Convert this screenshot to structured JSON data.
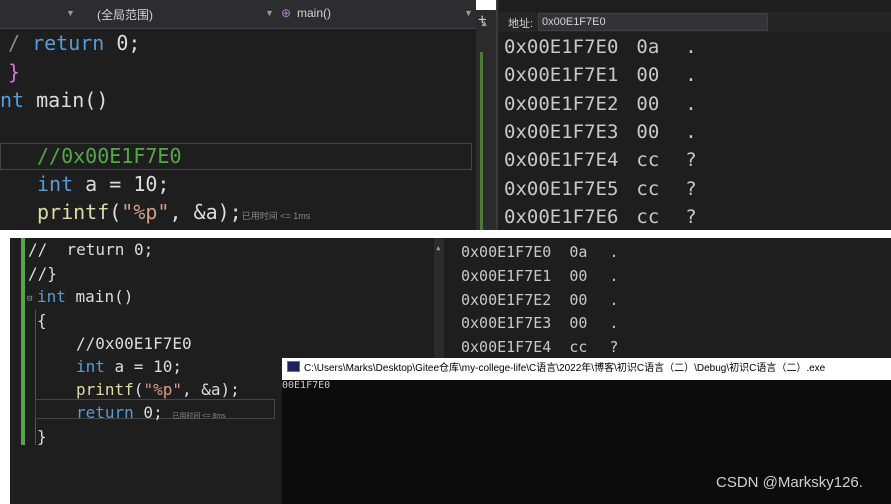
{
  "top": {
    "nav": {
      "scope": "(全局范围)",
      "function_icon": "function-icon",
      "function": "main()"
    },
    "code_lines": {
      "l1_kw": "return",
      "l1_rest": " 0;",
      "l2": "}",
      "l3_kw": "nt",
      "l3_rest": " main()",
      "l5": "//0x00E1F7E0",
      "l6_kw": "int",
      "l6_rest": " a = 10;",
      "l7_fn": "printf",
      "l7_open": "(",
      "l7_str": "\"%p\"",
      "l7_rest": ", &a);",
      "l7_hint": "已用时间 <= 1ms"
    },
    "memory": {
      "address_label": "地址:",
      "address_value": "0x00E1F7E0",
      "rows": [
        {
          "addr": "0x00E1F7E0",
          "hex": "0a",
          "ch": "."
        },
        {
          "addr": "0x00E1F7E1",
          "hex": "00",
          "ch": "."
        },
        {
          "addr": "0x00E1F7E2",
          "hex": "00",
          "ch": "."
        },
        {
          "addr": "0x00E1F7E3",
          "hex": "00",
          "ch": "."
        },
        {
          "addr": "0x00E1F7E4",
          "hex": "cc",
          "ch": "?"
        },
        {
          "addr": "0x00E1F7E5",
          "hex": "cc",
          "ch": "?"
        },
        {
          "addr": "0x00E1F7E6",
          "hex": "cc",
          "ch": "?"
        }
      ]
    }
  },
  "bottom": {
    "code_lines": {
      "c1": "//  return 0;",
      "c2": "//}",
      "c3_kw": "int",
      "c3_rest": " main()",
      "c4": "{",
      "c5": "//0x00E1F7E0",
      "c6_kw": "int",
      "c6_rest": " a = 10;",
      "c7_fn": "printf",
      "c7_open": "(",
      "c7_str": "\"%p\"",
      "c7_rest": ", &a);",
      "c8_kw": "return",
      "c8_rest": " 0;",
      "c8_hint": "已用时间 <= 8ms",
      "c9": "}"
    },
    "memory_rows": [
      {
        "addr": "0x00E1F7E0",
        "hex": "0a",
        "ch": "."
      },
      {
        "addr": "0x00E1F7E1",
        "hex": "00",
        "ch": "."
      },
      {
        "addr": "0x00E1F7E2",
        "hex": "00",
        "ch": "."
      },
      {
        "addr": "0x00E1F7E3",
        "hex": "00",
        "ch": "."
      },
      {
        "addr": "0x00E1F7E4",
        "hex": "cc",
        "ch": "?"
      }
    ],
    "console": {
      "title": "C:\\Users\\Marks\\Desktop\\Gitee仓库\\my-college-life\\C语言\\2022年\\博客\\初识C语言（二）\\Debug\\初识C语言（二）.exe",
      "output": "00E1F7E0"
    }
  },
  "watermark": "CSDN @Marksky126."
}
